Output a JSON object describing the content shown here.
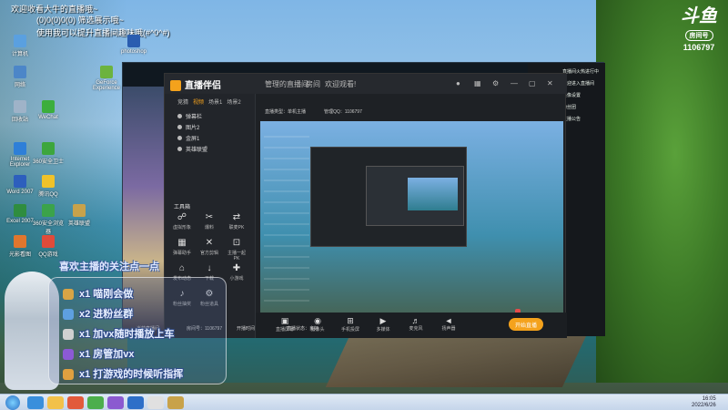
{
  "banner": {
    "line1": "欢迎收看大牛的直播哦~",
    "line2": "(0)0(0)0(0) 筛选展示哦~",
    "line3": "使用我可以提升直播间趣味哦(#^0^#)"
  },
  "douyu": {
    "logo": "斗鱼",
    "sub": "房间号",
    "room_id": "1106797"
  },
  "desktop_icons": [
    {
      "label": "计算机",
      "color": "#5aa0e0"
    },
    {
      "label": "网络",
      "color": "#4c86c8"
    },
    {
      "label": "回收站",
      "color": "#9fb3c8"
    },
    {
      "label": "Internet Explorer",
      "color": "#2e7fd8"
    },
    {
      "label": "Word 2007",
      "color": "#2d5fbd"
    },
    {
      "label": "Excel 2007",
      "color": "#2f8d3f"
    },
    {
      "label": "光影看图",
      "color": "#e0762e"
    },
    {
      "label": "360安全卫士",
      "color": "#3da63d"
    },
    {
      "label": "腾讯QQ",
      "color": "#f0c22a"
    },
    {
      "label": "360安全浏览器",
      "color": "#3ba34a"
    },
    {
      "label": "WeChat",
      "color": "#3cae3c"
    },
    {
      "label": "QQ游戏",
      "color": "#e04b3a"
    },
    {
      "label": "英雄联盟",
      "color": "#c8a24a"
    },
    {
      "label": "photoshop",
      "color": "#2a5db0"
    },
    {
      "label": "GeForce Experience",
      "color": "#6cb33e"
    }
  ],
  "client_window": {
    "chat": [
      "直播间火热进行中",
      "欢迎进入直播间",
      "头像设置",
      "粉丝团",
      "主播公告"
    ]
  },
  "companion": {
    "brand": "直播伴侣",
    "title_label": "管理的直播间",
    "room_label": "房间",
    "room_link": "欢迎观看!",
    "room_type": "直播类型：单机主播",
    "manager_qq": "管理QQ：1106797",
    "tabs": [
      "竞猜",
      "视频",
      "场景1",
      "场景2"
    ],
    "scenes": [
      "弹幕栏",
      "图片2",
      "金屏1",
      "英雄联盟"
    ],
    "tools_title": "工具箱",
    "tools": [
      {
        "icon": "☍",
        "label": "虚拟形象"
      },
      {
        "icon": "✂",
        "label": "爆料"
      },
      {
        "icon": "⇄",
        "label": "联麦PK"
      },
      {
        "icon": "▦",
        "label": "弹幕助手"
      },
      {
        "icon": "✕",
        "label": "官方剪辑"
      },
      {
        "icon": "⊡",
        "label": "主播一起PK"
      },
      {
        "icon": "⌂",
        "label": "发布动态"
      },
      {
        "icon": "↓",
        "label": "下载"
      },
      {
        "icon": "✚",
        "label": "小游戏"
      },
      {
        "icon": "♪",
        "label": "粉丝抽奖"
      },
      {
        "icon": "⚙",
        "label": "粉丝道具"
      }
    ],
    "volume": "100",
    "bottom": [
      {
        "icon": "▣",
        "label": "直播屏幕"
      },
      {
        "icon": "◉",
        "label": "摄像头"
      },
      {
        "icon": "⊞",
        "label": "手机投屏"
      },
      {
        "icon": "▶",
        "label": "多媒体"
      },
      {
        "icon": "♬",
        "label": "麦克风"
      },
      {
        "icon": "◄",
        "label": "扬声器"
      }
    ],
    "start_label": "开始直播",
    "status": [
      "当前直播间",
      "房间号：1106797",
      "开播时间",
      "直播状态：良好"
    ]
  },
  "overlay": {
    "title": "喜欢主播的关注点一点",
    "gifts": [
      {
        "text": "x1 喵刚会做",
        "color": "#d9a445"
      },
      {
        "text": "x2 进粉丝群",
        "color": "#5ea0e0"
      },
      {
        "text": "x1 加vx随时播放上车",
        "color": "#d0d0d0"
      },
      {
        "text": "x1 房管加vx",
        "color": "#8c5ad6"
      },
      {
        "text": "x1 打游戏的时候听指挥",
        "color": "#e0a040"
      }
    ]
  },
  "taskbar": {
    "apps": [
      "#3a8fdc",
      "#f2c14a",
      "#e25a3c",
      "#4cae4c",
      "#8b5ad0",
      "#2e6fc8",
      "#e0e0e0",
      "#c8a24a"
    ],
    "time": "16:05",
    "date": "2022/6/26"
  }
}
